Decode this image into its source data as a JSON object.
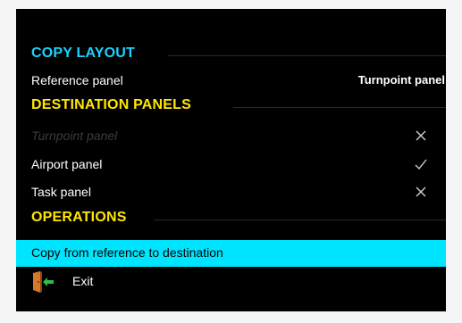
{
  "theme": {
    "section_color": "#ffe600",
    "copy_layout_color": "#19d4ff",
    "highlight_color": "#00e5ff",
    "text_color": "#ffffff",
    "disabled_color": "#3b3b3b"
  },
  "copy_layout": {
    "title": "COPY LAYOUT",
    "reference_label": "Reference panel",
    "reference_value": "Turnpoint panel"
  },
  "destination_panels": {
    "title": "DESTINATION PANELS",
    "items": [
      {
        "label": "Turnpoint panel",
        "state": "disabled",
        "mark_icon": "cross-icon"
      },
      {
        "label": "Airport panel",
        "state": "checked",
        "mark_icon": "check-icon"
      },
      {
        "label": "Task panel",
        "state": "unchecked",
        "mark_icon": "cross-icon"
      }
    ]
  },
  "operations": {
    "title": "OPERATIONS",
    "copy_action": "Copy from reference to destination",
    "exit_label": "Exit",
    "exit_icon": "exit-door-icon"
  }
}
